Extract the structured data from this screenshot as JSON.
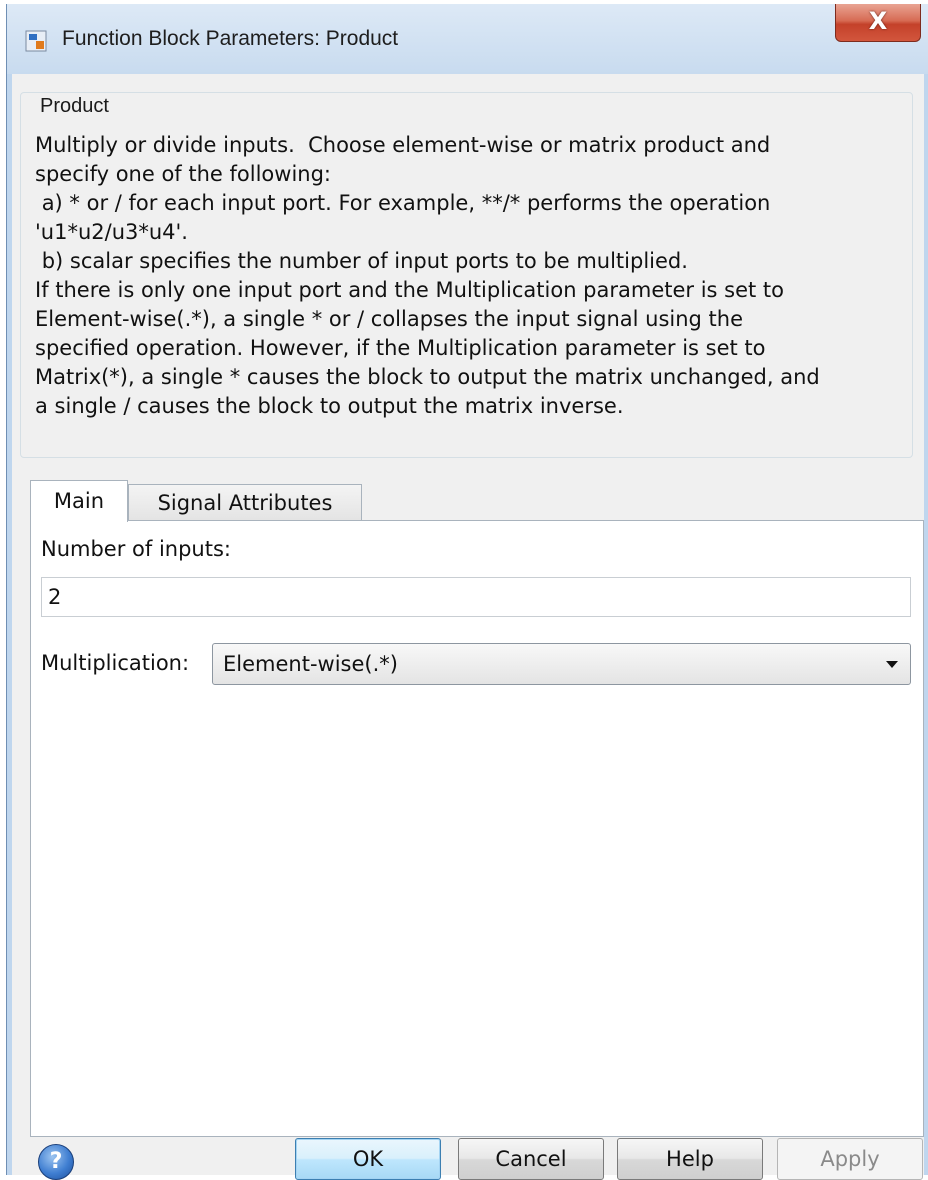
{
  "window": {
    "title": "Function Block Parameters: Product",
    "close_label": "X"
  },
  "group": {
    "legend": "Product",
    "description": "Multiply or divide inputs.  Choose element-wise or matrix product and\nspecify one of the following:\n a) * or / for each input port. For example, **/* performs the operation\n'u1*u2/u3*u4'.\n b) scalar specifies the number of input ports to be multiplied.\nIf there is only one input port and the Multiplication parameter is set to\nElement-wise(.*), a single * or / collapses the input signal using the\nspecified operation. However, if the Multiplication parameter is set to\nMatrix(*), a single * causes the block to output the matrix unchanged, and\na single / causes the block to output the matrix inverse."
  },
  "tabs": [
    {
      "label": "Main",
      "active": true
    },
    {
      "label": "Signal Attributes",
      "active": false
    }
  ],
  "main": {
    "inputs_label": "Number of inputs:",
    "inputs_value": "2",
    "multiplication_label": "Multiplication:",
    "multiplication_value": "Element-wise(.*)"
  },
  "buttons": {
    "help_icon": "?",
    "ok": "OK",
    "cancel": "Cancel",
    "help": "Help",
    "apply": "Apply"
  },
  "icons": [
    "simulink-block-icon",
    "close-icon",
    "help-icon",
    "dropdown-arrow-icon"
  ]
}
